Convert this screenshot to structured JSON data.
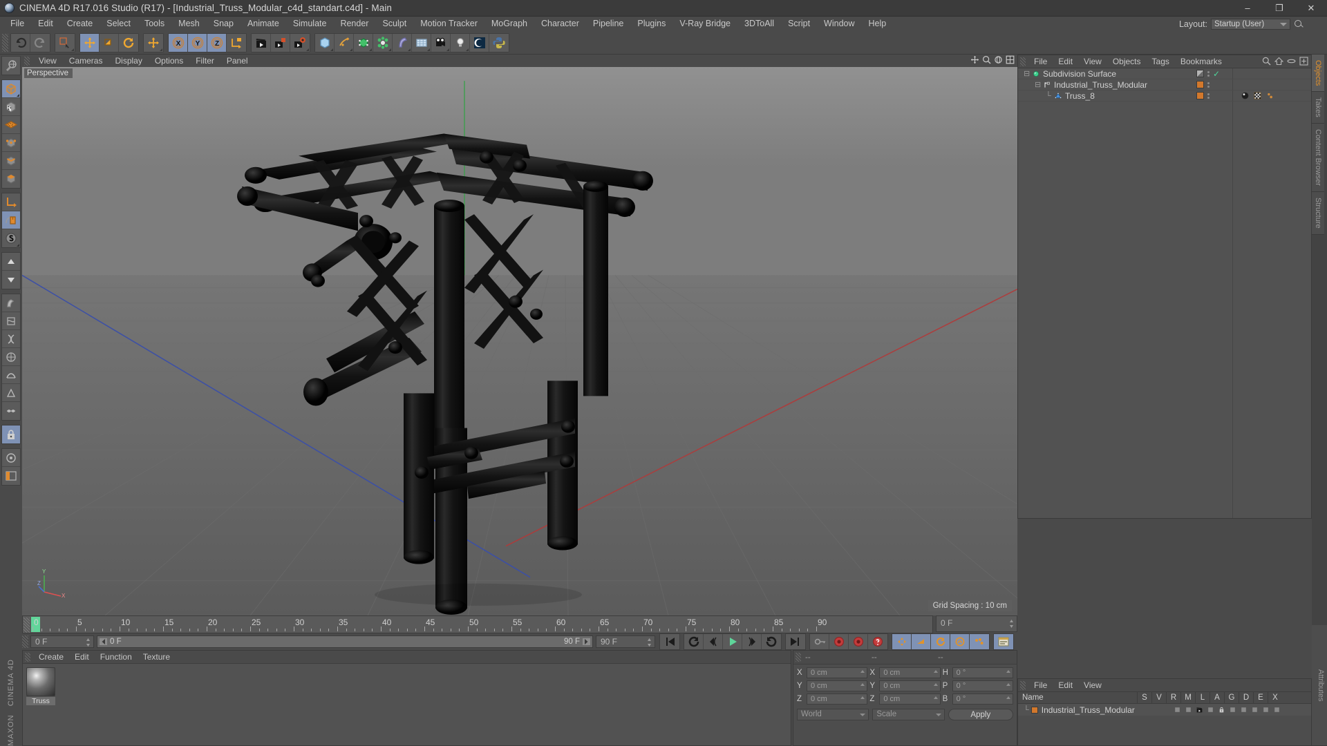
{
  "window": {
    "title": "CINEMA 4D R17.016 Studio (R17) - [Industrial_Truss_Modular_c4d_standart.c4d] - Main",
    "logo_icon": "c4d-sphere-logo",
    "minimize": "–",
    "maximize": "❐",
    "close": "✕"
  },
  "menubar": {
    "items": [
      "File",
      "Edit",
      "Create",
      "Select",
      "Tools",
      "Mesh",
      "Snap",
      "Animate",
      "Simulate",
      "Render",
      "Sculpt",
      "Motion Tracker",
      "MoGraph",
      "Character",
      "Pipeline",
      "Plugins",
      "V-Ray Bridge",
      "3DToAll",
      "Script",
      "Window",
      "Help"
    ],
    "layout_label": "Layout:",
    "layout_value": "Startup (User)",
    "search_icon": "search-icon"
  },
  "toolbar": {
    "groups": [
      {
        "buttons": [
          {
            "name": "undo-button",
            "icon": "undo-arrow-icon",
            "active": false
          },
          {
            "name": "redo-button",
            "icon": "redo-arrow-icon",
            "active": false,
            "disabled": true
          }
        ]
      },
      {
        "buttons": [
          {
            "name": "live-selection-button",
            "icon": "selection-rect-icon",
            "active": false,
            "corner": true
          }
        ]
      },
      {
        "buttons": [
          {
            "name": "move-tool-button",
            "icon": "move-arrows-icon",
            "active": true
          },
          {
            "name": "scale-tool-button",
            "icon": "scale-box-icon",
            "active": false
          },
          {
            "name": "rotate-tool-button",
            "icon": "rotate-circle-icon",
            "active": false
          }
        ]
      },
      {
        "buttons": [
          {
            "name": "move-duplicate-button",
            "icon": "move-arrows-icon",
            "active": false,
            "corner": true
          }
        ]
      },
      {
        "buttons": [
          {
            "name": "x-axis-lock-button",
            "icon": "axis-x-icon",
            "active": true,
            "char": "X"
          },
          {
            "name": "y-axis-lock-button",
            "icon": "axis-y-icon",
            "active": true,
            "char": "Y"
          },
          {
            "name": "z-axis-lock-button",
            "icon": "axis-z-icon",
            "active": true,
            "char": "Z"
          },
          {
            "name": "world-object-coord-button",
            "icon": "axis-cube-icon",
            "active": false
          }
        ]
      },
      {
        "buttons": [
          {
            "name": "render-view-button",
            "icon": "clapboard-icon",
            "active": false
          },
          {
            "name": "render-to-picture-viewer-button",
            "icon": "clapboard-picture-icon",
            "active": false
          },
          {
            "name": "render-settings-button",
            "icon": "clapboard-gear-icon",
            "active": false,
            "corner": true
          }
        ]
      },
      {
        "buttons": [
          {
            "name": "primitive-cube-button",
            "icon": "cube-icon",
            "active": false,
            "corner": true
          },
          {
            "name": "spline-pen-button",
            "icon": "pen-spline-icon",
            "active": false,
            "corner": true
          },
          {
            "name": "nurbs-generator-button",
            "icon": "green-cube-icon",
            "active": false,
            "corner": true
          },
          {
            "name": "array-modeling-button",
            "icon": "green-cluster-icon",
            "active": false,
            "corner": true
          },
          {
            "name": "bend-deformer-button",
            "icon": "bend-deformer-icon",
            "active": false,
            "corner": true
          },
          {
            "name": "floor-environment-button",
            "icon": "grid-floor-icon",
            "active": false,
            "corner": true
          },
          {
            "name": "camera-button",
            "icon": "camera-icon",
            "active": false,
            "corner": true
          },
          {
            "name": "light-button",
            "icon": "lightbulb-icon",
            "active": false,
            "corner": true
          },
          {
            "name": "content-browser-button",
            "icon": "c4d-logo-icon",
            "active": false
          },
          {
            "name": "python-script-button",
            "icon": "python-icon",
            "active": false
          }
        ]
      }
    ]
  },
  "left_toolbar": {
    "buttons": [
      {
        "name": "make-editable-button",
        "icon": "globe-convert-icon",
        "active": false
      },
      {
        "name": "model-mode-button",
        "icon": "orange-cube-icon",
        "active": true,
        "corner": true
      },
      {
        "name": "texture-mode-button",
        "icon": "checker-cube-icon",
        "active": false
      },
      {
        "name": "workplane-mode-button",
        "icon": "orange-plane-icon",
        "active": false
      },
      {
        "name": "point-mode-button",
        "icon": "point-cube-icon",
        "active": false
      },
      {
        "name": "edge-mode-button",
        "icon": "edge-cube-icon",
        "active": false
      },
      {
        "name": "polygon-mode-button",
        "icon": "polygon-cube-icon",
        "active": false
      },
      {
        "name": "object-axis-button",
        "icon": "axis-l-icon",
        "active": false
      },
      {
        "name": "enable-snap-button",
        "icon": "mouse-icon",
        "active": true
      },
      {
        "name": "snap-settings-button",
        "icon": "letter-s-icon",
        "active": false,
        "corner": true
      },
      {
        "name": "viewport-solo-button",
        "icon": "triangle-up-icon",
        "active": false
      },
      {
        "name": "move-down-button",
        "icon": "triangle-down-icon",
        "active": false
      },
      {
        "name": "deformer-a-button",
        "icon": "deformer-a-icon",
        "active": false
      },
      {
        "name": "deformer-b-button",
        "icon": "deformer-b-icon",
        "active": false
      },
      {
        "name": "deformer-c-button",
        "icon": "deformer-c-icon",
        "active": false
      },
      {
        "name": "deformer-d-button",
        "icon": "deformer-d-icon",
        "active": false
      },
      {
        "name": "deformer-e-button",
        "icon": "deformer-e-icon",
        "active": false
      },
      {
        "name": "deformer-f-button",
        "icon": "deformer-f-icon",
        "active": false
      },
      {
        "name": "deformer-g-button",
        "icon": "deformer-g-icon",
        "active": false
      },
      {
        "name": "lock-button",
        "icon": "lock-icon",
        "active": true
      },
      {
        "name": "circle-tool-button",
        "icon": "circle-tool-icon",
        "active": false
      },
      {
        "name": "layout-tool-button",
        "icon": "layout-tool-icon",
        "active": false
      }
    ],
    "brand": "CINEMA 4D",
    "brand_top": "MAXON"
  },
  "viewport": {
    "menu": [
      "View",
      "Cameras",
      "Display",
      "Options",
      "Filter",
      "Panel"
    ],
    "label": "Perspective",
    "grid_spacing": "Grid Spacing : 10 cm",
    "axis": {
      "x": "X",
      "y": "Y",
      "z": "Z"
    },
    "nav_icons": [
      "pan-icon",
      "zoom-icon",
      "rotate-icon",
      "maximize-view-icon"
    ]
  },
  "object_manager": {
    "menu": [
      "File",
      "Edit",
      "View",
      "Objects",
      "Tags",
      "Bookmarks"
    ],
    "header_icons": [
      "search-icon",
      "home-icon",
      "ellipse-icon",
      "expand-icon"
    ],
    "rows": [
      {
        "name": "Subdivision Surface",
        "indent": 0,
        "icon_color": "#3fcf8e",
        "icon": "subdivision-surface-icon",
        "swatch": "#888888",
        "swatch_type": "gradient",
        "check": true,
        "tags": []
      },
      {
        "name": "Industrial_Truss_Modular",
        "indent": 1,
        "icon_color": "#d8d8d8",
        "icon": "null-object-icon",
        "swatch": "#d2782c",
        "swatch_type": "solid",
        "check": false,
        "tags": []
      },
      {
        "name": "Truss_8",
        "indent": 2,
        "icon_color": "#4a90d9",
        "icon": "polygon-object-icon",
        "swatch": "#d2782c",
        "swatch_type": "solid",
        "check": false,
        "tags": [
          "material-tag",
          "texture-tag",
          "uv-tag"
        ]
      }
    ]
  },
  "right_tabs": [
    {
      "label": "Objects",
      "active": true
    },
    {
      "label": "Takes",
      "active": false
    },
    {
      "label": "Content Browser",
      "active": false
    },
    {
      "label": "Structure",
      "active": false
    }
  ],
  "attribute_manager": {
    "menu": [
      "File",
      "Edit",
      "View"
    ],
    "columns": [
      "Name",
      "S",
      "V",
      "R",
      "M",
      "L",
      "A",
      "G",
      "D",
      "E",
      "X"
    ],
    "rows": [
      {
        "name": "Industrial_Truss_Modular",
        "swatch": "#d2782c"
      }
    ],
    "tab_label": "Attributes"
  },
  "timeline": {
    "ticks": [
      0,
      5,
      10,
      15,
      20,
      25,
      30,
      35,
      40,
      45,
      50,
      55,
      60,
      65,
      70,
      75,
      80,
      85,
      90
    ],
    "current_frame_marker": 0,
    "end_field": "0 F",
    "start_field": "0 F",
    "scrub_left": "0 F",
    "scrub_right": "90 F",
    "preview_end": "90 F",
    "transport": [
      {
        "name": "go-to-start-button",
        "icon": "skip-back-icon"
      },
      {
        "name": "play-backwards-loop-button",
        "icon": "loop-back-icon"
      },
      {
        "name": "step-back-button",
        "icon": "step-back-icon"
      },
      {
        "name": "play-button",
        "icon": "play-icon",
        "accent": "#61d69a"
      },
      {
        "name": "step-forward-button",
        "icon": "step-forward-icon"
      },
      {
        "name": "loop-forward-button",
        "icon": "loop-forward-icon"
      },
      {
        "name": "go-to-end-button",
        "icon": "skip-forward-icon"
      }
    ],
    "record_group": [
      {
        "name": "autokey-button",
        "icon": "key-icon"
      },
      {
        "name": "record-active-objects-button",
        "icon": "record-red-icon"
      },
      {
        "name": "autokeying-button",
        "icon": "record-red-icon"
      },
      {
        "name": "keyframe-help-button",
        "icon": "question-red-icon"
      }
    ],
    "key_group": [
      {
        "name": "position-key-button",
        "icon": "position-key-icon",
        "active": true
      },
      {
        "name": "scale-key-button",
        "icon": "scale-key-icon",
        "active": true
      },
      {
        "name": "rotation-key-button",
        "icon": "rotation-key-icon",
        "active": true
      },
      {
        "name": "param-key-button",
        "icon": "param-key-icon",
        "active": true
      },
      {
        "name": "point-level-anim-button",
        "icon": "pla-icon",
        "active": true
      }
    ],
    "view_group": [
      {
        "name": "timeline-view-button",
        "icon": "timeline-view-icon",
        "active": true
      }
    ]
  },
  "material_manager": {
    "menu": [
      "Create",
      "Edit",
      "Function",
      "Texture"
    ],
    "materials": [
      {
        "name": "Truss",
        "preview": "shiny-dark-sphere"
      }
    ]
  },
  "coordinate_manager": {
    "headers": [
      "--",
      "--",
      "--"
    ],
    "rows": [
      {
        "l1": "X",
        "v1": "0 cm",
        "l2": "X",
        "v2": "0 cm",
        "l3": "H",
        "v3": "0 °"
      },
      {
        "l1": "Y",
        "v1": "0 cm",
        "l2": "Y",
        "v2": "0 cm",
        "l3": "P",
        "v3": "0 °"
      },
      {
        "l1": "Z",
        "v1": "0 cm",
        "l2": "Z",
        "v2": "0 cm",
        "l3": "B",
        "v3": "0 °"
      }
    ],
    "coord_system": "World",
    "size_mode": "Scale",
    "apply_label": "Apply"
  },
  "colors": {
    "accent_orange": "#d2782c",
    "accent_green": "#61d69a",
    "active_blue": "#7f92b5",
    "panel_bg": "#4a4a4a",
    "field_bg": "#595959",
    "tab_active_text": "#e0902c"
  }
}
